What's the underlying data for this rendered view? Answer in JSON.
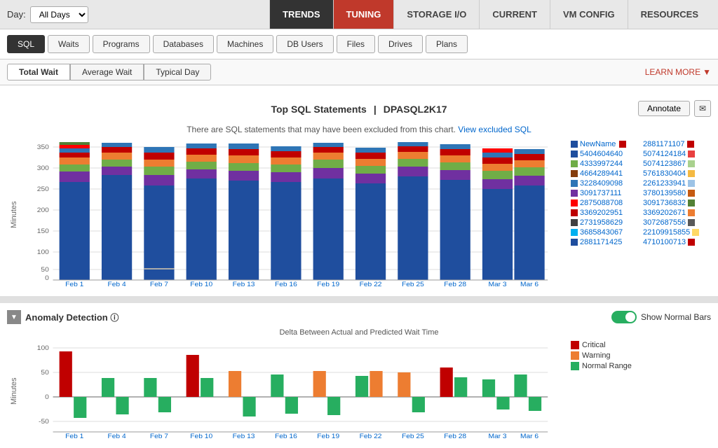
{
  "topnav": {
    "day_label": "Day:",
    "day_options": [
      "All Days"
    ],
    "day_selected": "All Days",
    "tabs": [
      {
        "label": "TRENDS",
        "active": true,
        "style": "dark"
      },
      {
        "label": "TUNING",
        "active": false,
        "style": "red"
      },
      {
        "label": "STORAGE I/O",
        "active": false,
        "style": "normal"
      },
      {
        "label": "CURRENT",
        "active": false,
        "style": "normal"
      },
      {
        "label": "VM CONFIG",
        "active": false,
        "style": "normal"
      },
      {
        "label": "RESOURCES",
        "active": false,
        "style": "normal"
      }
    ]
  },
  "subtabs": {
    "items": [
      {
        "label": "SQL",
        "active": true
      },
      {
        "label": "Waits",
        "active": false
      },
      {
        "label": "Programs",
        "active": false
      },
      {
        "label": "Databases",
        "active": false
      },
      {
        "label": "Machines",
        "active": false
      },
      {
        "label": "DB Users",
        "active": false
      },
      {
        "label": "Files",
        "active": false
      },
      {
        "label": "Drives",
        "active": false
      },
      {
        "label": "Plans",
        "active": false
      }
    ]
  },
  "viewtabs": {
    "items": [
      {
        "label": "Total Wait",
        "active": true
      },
      {
        "label": "Average Wait",
        "active": false
      },
      {
        "label": "Typical Day",
        "active": false
      }
    ],
    "learn_more": "LEARN MORE"
  },
  "chart": {
    "title": "Top SQL Statements",
    "separator": "|",
    "server": "DPASQL2K17",
    "annotate_label": "Annotate",
    "excluded_msg": "There are SQL statements that may have been excluded from this chart.",
    "view_excluded_link": "View excluded SQL",
    "y_axis_label": "Minutes",
    "x_labels": [
      "Feb 1",
      "Feb 4",
      "Feb 7",
      "Feb 10",
      "Feb 13",
      "Feb 16",
      "Feb 19",
      "Feb 22",
      "Feb 25",
      "Feb 28",
      "Mar 3",
      "Mar 6"
    ],
    "y_ticks": [
      "350",
      "300",
      "250",
      "200",
      "150",
      "100",
      "50",
      "0"
    ]
  },
  "legend": {
    "items": [
      {
        "label": "NewName",
        "color": "#1f4e9e"
      },
      {
        "label": "2881171107",
        "color": "#c00000"
      },
      {
        "label": "5404604640",
        "color": "#1f4e9e"
      },
      {
        "label": "5074124184",
        "color": "#e84040"
      },
      {
        "label": "4333997244",
        "color": "#70ad47"
      },
      {
        "label": "5074123867",
        "color": "#a9d18e"
      },
      {
        "label": "4664289441",
        "color": "#843c0c"
      },
      {
        "label": "5761830404",
        "color": "#f4b942"
      },
      {
        "label": "3228409098",
        "color": "#2e75b6"
      },
      {
        "label": "2261233941",
        "color": "#9dc3e6"
      },
      {
        "label": "3091737111",
        "color": "#7030a0"
      },
      {
        "label": "3780139580",
        "color": "#c55a11"
      },
      {
        "label": "2875088708",
        "color": "#ff0000"
      },
      {
        "label": "3091736832",
        "color": "#538135"
      },
      {
        "label": "3369202951",
        "color": "#be0000"
      },
      {
        "label": "3369202671",
        "color": "#ed7d31"
      },
      {
        "label": "2731958629",
        "color": "#404040"
      },
      {
        "label": "3072687556",
        "color": "#595959"
      },
      {
        "label": "3685843067",
        "color": "#00b0f0"
      },
      {
        "label": "22109915855",
        "color": "#ffd966"
      },
      {
        "label": "2881171425",
        "color": "#1f4e9e"
      },
      {
        "label": "4710100713",
        "color": "#c00000"
      }
    ]
  },
  "anomaly": {
    "collapse_label": "▼",
    "title": "Anomaly Detection",
    "info_icon": "ⓘ",
    "subtitle": "Delta Between Actual and Predicted Wait Time",
    "show_normal_label": "Show Normal Bars",
    "y_axis_label": "Minutes",
    "x_labels": [
      "Feb 1",
      "Feb 4",
      "Feb 7",
      "Feb 10",
      "Feb 13",
      "Feb 16",
      "Feb 19",
      "Feb 22",
      "Feb 25",
      "Feb 28",
      "Mar 3",
      "Mar 6"
    ],
    "legend": [
      {
        "label": "Critical",
        "color": "#c00000"
      },
      {
        "label": "Warning",
        "color": "#ed7d31"
      },
      {
        "label": "Normal Range",
        "color": "#27ae60"
      }
    ],
    "y_ticks": [
      "100",
      "50",
      "0",
      "-50"
    ]
  }
}
